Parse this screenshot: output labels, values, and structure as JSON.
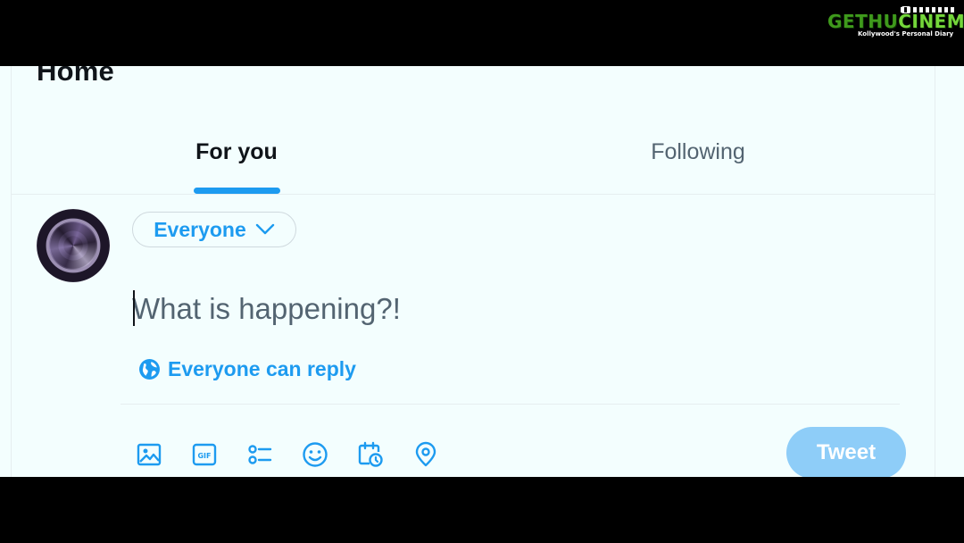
{
  "header": {
    "title": "Home"
  },
  "tabs": [
    {
      "label": "For you",
      "active": true
    },
    {
      "label": "Following",
      "active": false
    }
  ],
  "composer": {
    "audience_label": "Everyone",
    "audience_icon": "chevron-down-icon",
    "placeholder": "What is happening?!",
    "value": "",
    "reply_setting": "Everyone can reply",
    "reply_icon": "globe-icon",
    "tools": [
      {
        "name": "media-icon"
      },
      {
        "name": "gif-icon"
      },
      {
        "name": "poll-icon"
      },
      {
        "name": "emoji-icon"
      },
      {
        "name": "schedule-icon"
      },
      {
        "name": "location-icon"
      }
    ],
    "submit_label": "Tweet",
    "submit_enabled": false
  },
  "watermark": {
    "brand_a": "GETHU",
    "brand_b": "CINEMA",
    "tagline": "Kollywood's Personal Diary"
  },
  "colors": {
    "accent": "#1d9bf0",
    "submit_disabled": "#8ecdf8",
    "background": "#f3fefe",
    "text_primary": "#0f1419",
    "text_secondary": "#536471",
    "letterbox": "#000000"
  }
}
